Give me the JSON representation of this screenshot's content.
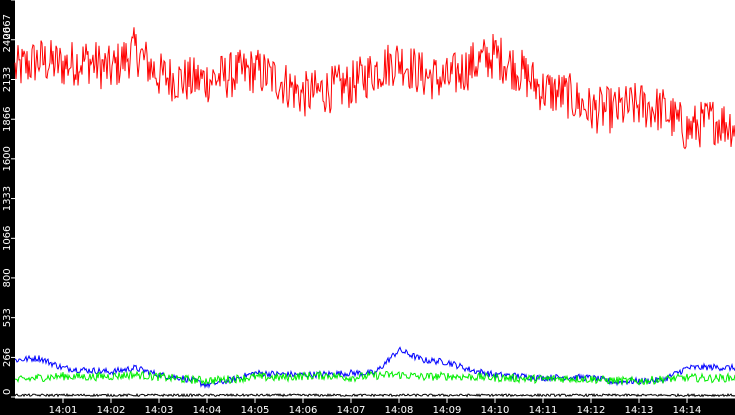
{
  "chart_data": {
    "type": "line",
    "title": "",
    "xlabel": "",
    "ylabel": "",
    "x_start": "14:00",
    "x_end": "14:15",
    "x_step_minutes": 0.5,
    "xlim_minutes": [
      0,
      15
    ],
    "ylim": [
      0,
      2667
    ],
    "y_ticks": [
      "0",
      "266",
      "533",
      "800",
      "1066",
      "1333",
      "1600",
      "1866",
      "2133",
      "2400",
      "2667"
    ],
    "x_ticks": [
      "14:01",
      "14:02",
      "14:03",
      "14:04",
      "14:05",
      "14:06",
      "14:07",
      "14:08",
      "14:09",
      "14:10",
      "14:11",
      "14:12",
      "14:13",
      "14:14"
    ],
    "grid": false,
    "series": [
      {
        "name": "red",
        "color": "#ff0000",
        "noise": 160,
        "values": [
          2196,
          2263,
          2230,
          2263,
          2196,
          2330,
          2160,
          2129,
          2129,
          2163,
          2196,
          2129,
          2028,
          2062,
          2095,
          2196,
          2263,
          2163,
          2129,
          2230,
          2297,
          2196,
          2062,
          2028,
          1927,
          1927,
          1961,
          1927,
          1793,
          1860,
          1826
        ]
      },
      {
        "name": "blue",
        "color": "#0000ff",
        "noise": 22,
        "values": [
          248,
          262,
          195,
          181,
          168,
          195,
          148,
          128,
          81,
          114,
          161,
          154,
          148,
          154,
          161,
          161,
          316,
          248,
          235,
          181,
          148,
          141,
          128,
          134,
          128,
          101,
          107,
          114,
          195,
          201,
          195
        ]
      },
      {
        "name": "green",
        "color": "#00ee00",
        "noise": 28,
        "values": [
          110,
          130,
          140,
          135,
          140,
          150,
          135,
          120,
          110,
          120,
          135,
          130,
          140,
          145,
          130,
          145,
          150,
          135,
          140,
          135,
          130,
          125,
          120,
          125,
          120,
          110,
          105,
          120,
          130,
          125,
          130
        ]
      },
      {
        "name": "black",
        "color": "#000000",
        "noise": 8,
        "values": [
          12,
          12,
          12,
          12,
          12,
          12,
          12,
          12,
          12,
          12,
          12,
          12,
          12,
          12,
          12,
          12,
          12,
          12,
          12,
          12,
          12,
          12,
          12,
          12,
          12,
          12,
          12,
          12,
          12,
          12,
          12
        ]
      }
    ]
  }
}
